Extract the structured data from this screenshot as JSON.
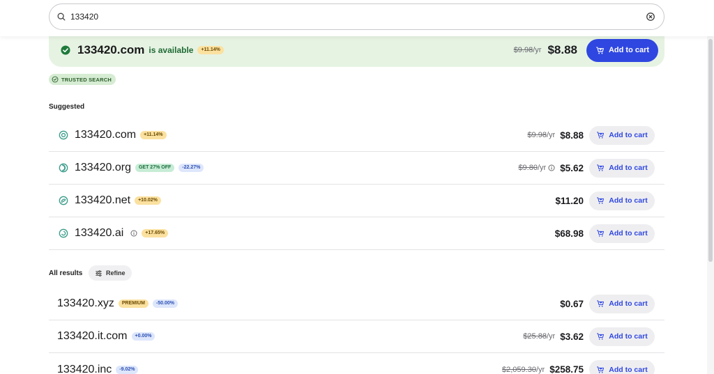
{
  "search": {
    "value": "133420"
  },
  "featured": {
    "domain": "133420.com",
    "status": "is available",
    "badge": "+11.14%",
    "old_price": "$9.98",
    "unit": "/yr",
    "price": "$8.88",
    "cta": "Add to cart"
  },
  "trusted": "TRUSTED SEARCH",
  "suggested_heading": "Suggested",
  "suggested": [
    {
      "name": "133420.com",
      "badges": [
        {
          "text": "+11.14%",
          "color": "yellow"
        }
      ],
      "old_price": "$9.98",
      "unit": "/yr",
      "price": "$8.88",
      "cta": "Add to cart"
    },
    {
      "name": "133420.org",
      "badges": [
        {
          "text": "GET 27% OFF",
          "color": "green"
        },
        {
          "text": "-22.27%",
          "color": "blue"
        }
      ],
      "old_price": "$9.80",
      "unit": "/yr",
      "price": "$5.62",
      "cta": "Add to cart"
    },
    {
      "name": "133420.net",
      "badges": [
        {
          "text": "+10.02%",
          "color": "yellow"
        }
      ],
      "old_price": "",
      "unit": "",
      "price": "$11.20",
      "cta": "Add to cart"
    },
    {
      "name": "133420.ai",
      "badges": [
        {
          "text": "+17.65%",
          "color": "yellow"
        }
      ],
      "old_price": "",
      "unit": "",
      "price": "$68.98",
      "cta": "Add to cart"
    }
  ],
  "all_heading": "All results",
  "refine_label": "Refine",
  "results": [
    {
      "name": "133420.xyz",
      "badges": [
        {
          "text": "PREMIUM",
          "color": "yellow"
        },
        {
          "text": "-50.00%",
          "color": "blue"
        }
      ],
      "old_price": "",
      "unit": "",
      "price": "$0.67",
      "cta": "Add to cart"
    },
    {
      "name": "133420.it.com",
      "badges": [
        {
          "text": "+0.00%",
          "color": "blue"
        }
      ],
      "old_price": "$25.88",
      "unit": "/yr",
      "price": "$3.62",
      "cta": "Add to cart"
    },
    {
      "name": "133420.inc",
      "badges": [
        {
          "text": "-9.02%",
          "color": "blue"
        }
      ],
      "old_price": "$2,059.30",
      "unit": "/yr",
      "price": "$258.75",
      "cta": "Add to cart"
    }
  ],
  "colors": {
    "primary": "#2f47e0",
    "available_bg": "#e6f3e3",
    "available_text": "#1f6a33"
  }
}
